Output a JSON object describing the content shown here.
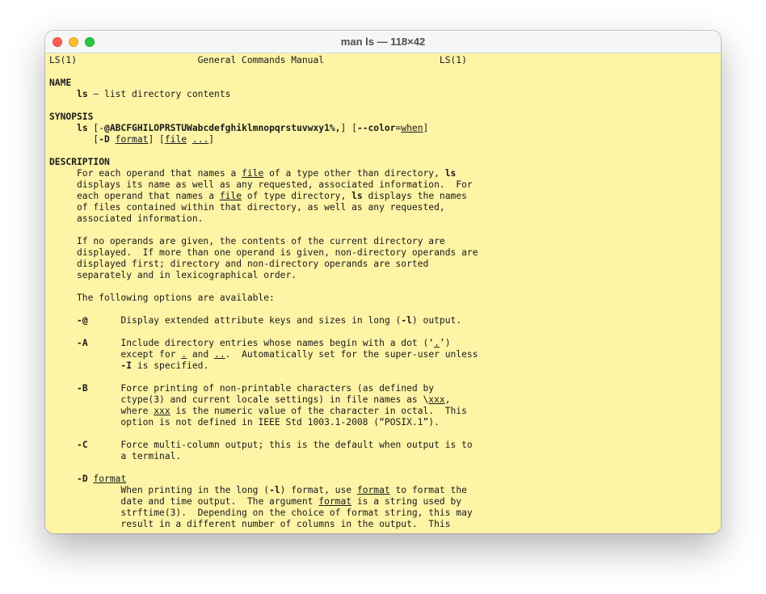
{
  "window": {
    "title": "man ls — 118×42",
    "controls": {
      "close": "close-button",
      "minimize": "minimize-button",
      "zoom": "zoom-button"
    }
  },
  "terminal": {
    "lines": [
      [
        {
          "t": "LS(1)                      General Commands Manual                     LS(1)"
        }
      ],
      [
        {
          "t": ""
        }
      ],
      [
        {
          "t": "NAME",
          "b": true
        }
      ],
      [
        {
          "t": "     "
        },
        {
          "t": "ls",
          "b": true
        },
        {
          "t": " – list directory contents"
        }
      ],
      [
        {
          "t": ""
        }
      ],
      [
        {
          "t": "SYNOPSIS",
          "b": true
        }
      ],
      [
        {
          "t": "     "
        },
        {
          "t": "ls",
          "b": true
        },
        {
          "t": " [-"
        },
        {
          "t": "@ABCFGHILOPRSTUWabcdefghiklmnopqrstuvwxy1%,",
          "b": true
        },
        {
          "t": "] ["
        },
        {
          "t": "--color",
          "b": true
        },
        {
          "t": "="
        },
        {
          "t": "when",
          "u": true
        },
        {
          "t": "]"
        }
      ],
      [
        {
          "t": "        ["
        },
        {
          "t": "-D",
          "b": true
        },
        {
          "t": " "
        },
        {
          "t": "format",
          "u": true
        },
        {
          "t": "] ["
        },
        {
          "t": "file",
          "u": true
        },
        {
          "t": " "
        },
        {
          "t": "...",
          "u": true
        },
        {
          "t": "]"
        }
      ],
      [
        {
          "t": ""
        }
      ],
      [
        {
          "t": "DESCRIPTION",
          "b": true
        }
      ],
      [
        {
          "t": "     For each operand that names a "
        },
        {
          "t": "file",
          "u": true
        },
        {
          "t": " of a type other than directory, "
        },
        {
          "t": "ls",
          "b": true
        }
      ],
      [
        {
          "t": "     displays its name as well as any requested, associated information.  For"
        }
      ],
      [
        {
          "t": "     each operand that names a "
        },
        {
          "t": "file",
          "u": true
        },
        {
          "t": " of type directory, "
        },
        {
          "t": "ls",
          "b": true
        },
        {
          "t": " displays the names"
        }
      ],
      [
        {
          "t": "     of files contained within that directory, as well as any requested,"
        }
      ],
      [
        {
          "t": "     associated information."
        }
      ],
      [
        {
          "t": ""
        }
      ],
      [
        {
          "t": "     If no operands are given, the contents of the current directory are"
        }
      ],
      [
        {
          "t": "     displayed.  If more than one operand is given, non-directory operands are"
        }
      ],
      [
        {
          "t": "     displayed first; directory and non-directory operands are sorted"
        }
      ],
      [
        {
          "t": "     separately and in lexicographical order."
        }
      ],
      [
        {
          "t": ""
        }
      ],
      [
        {
          "t": "     The following options are available:"
        }
      ],
      [
        {
          "t": ""
        }
      ],
      [
        {
          "t": "     "
        },
        {
          "t": "-@",
          "b": true
        },
        {
          "t": "      Display extended attribute keys and sizes in long ("
        },
        {
          "t": "-l",
          "b": true
        },
        {
          "t": ") output."
        }
      ],
      [
        {
          "t": ""
        }
      ],
      [
        {
          "t": "     "
        },
        {
          "t": "-A",
          "b": true
        },
        {
          "t": "      Include directory entries whose names begin with a dot (‘"
        },
        {
          "t": ".",
          "u": true
        },
        {
          "t": "’)"
        }
      ],
      [
        {
          "t": "             except for "
        },
        {
          "t": ".",
          "u": true
        },
        {
          "t": " and "
        },
        {
          "t": "..",
          "u": true
        },
        {
          "t": ".  Automatically set for the super-user unless"
        }
      ],
      [
        {
          "t": "             "
        },
        {
          "t": "-I",
          "b": true
        },
        {
          "t": " is specified."
        }
      ],
      [
        {
          "t": ""
        }
      ],
      [
        {
          "t": "     "
        },
        {
          "t": "-B",
          "b": true
        },
        {
          "t": "      Force printing of non-printable characters (as defined by"
        }
      ],
      [
        {
          "t": "             ctype(3) and current locale settings) in file names as \\"
        },
        {
          "t": "xxx",
          "u": true
        },
        {
          "t": ","
        }
      ],
      [
        {
          "t": "             where "
        },
        {
          "t": "xxx",
          "u": true
        },
        {
          "t": " is the numeric value of the character in octal.  This"
        }
      ],
      [
        {
          "t": "             option is not defined in IEEE Std 1003.1-2008 (“POSIX.1”)."
        }
      ],
      [
        {
          "t": ""
        }
      ],
      [
        {
          "t": "     "
        },
        {
          "t": "-C",
          "b": true
        },
        {
          "t": "      Force multi-column output; this is the default when output is to"
        }
      ],
      [
        {
          "t": "             a terminal."
        }
      ],
      [
        {
          "t": ""
        }
      ],
      [
        {
          "t": "     "
        },
        {
          "t": "-D",
          "b": true
        },
        {
          "t": " "
        },
        {
          "t": "format",
          "u": true
        }
      ],
      [
        {
          "t": "             When printing in the long ("
        },
        {
          "t": "-l",
          "b": true
        },
        {
          "t": ") format, use "
        },
        {
          "t": "format",
          "u": true
        },
        {
          "t": " to format the"
        }
      ],
      [
        {
          "t": "             date and time output.  The argument "
        },
        {
          "t": "format",
          "u": true
        },
        {
          "t": " is a string used by"
        }
      ],
      [
        {
          "t": "             strftime(3).  Depending on the choice of format string, this may"
        }
      ],
      [
        {
          "t": "             result in a different number of columns in the output.  This"
        }
      ]
    ]
  }
}
